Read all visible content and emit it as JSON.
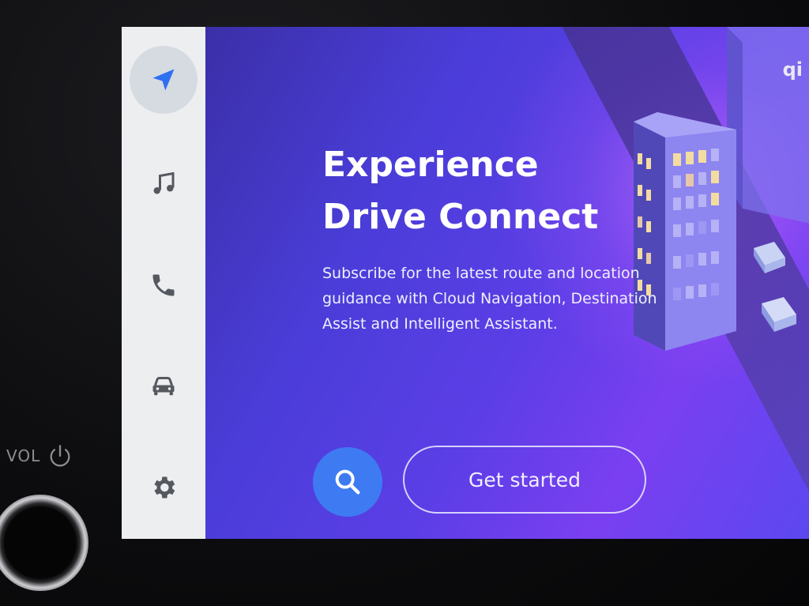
{
  "bezel": {
    "vol_label": "VOL",
    "power_icon": "power-icon"
  },
  "sidebar": {
    "items": [
      {
        "icon": "navigation-arrow-icon",
        "active": true
      },
      {
        "icon": "music-note-icon",
        "active": false
      },
      {
        "icon": "phone-icon",
        "active": false
      },
      {
        "icon": "car-icon",
        "active": false
      },
      {
        "icon": "gear-icon",
        "active": false
      }
    ]
  },
  "main": {
    "title": "Experience Drive Connect",
    "description": "Subscribe for the latest route and location guidance with Cloud Navigation, Destination Assist and Intelligent Assistant.",
    "search_icon": "search-icon",
    "cta_label": "Get started",
    "qi_label": "qi"
  },
  "colors": {
    "accent_blue": "#3e7bf2",
    "sidebar_bg": "#eceef0",
    "active_icon": "#2f6ff0",
    "icon_gray": "#55585e",
    "bg_purple": "#5b3ee6"
  }
}
